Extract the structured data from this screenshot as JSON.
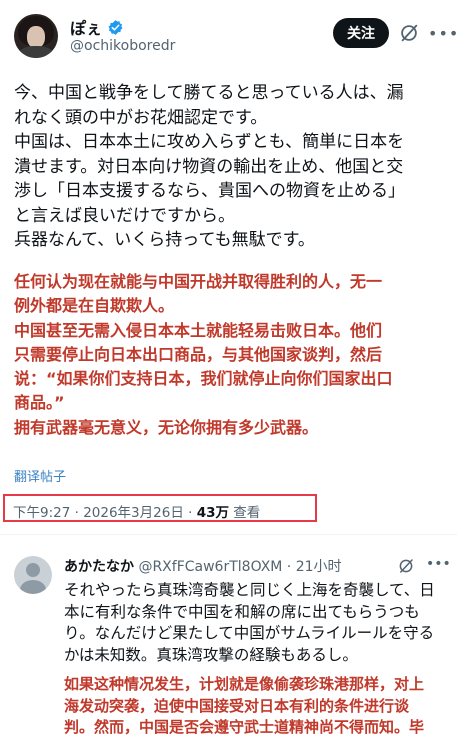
{
  "author": {
    "display_name": "ぽぇ",
    "handle": "@ochikoboredr",
    "avatar": "avatar-icon",
    "verified_icon": "verified-badge-icon"
  },
  "actions": {
    "follow_label": "关注",
    "grok_icon": "grok-slash-icon",
    "more_icon": "more-icon"
  },
  "post": {
    "text": "今、中国と戦争をして勝てると思っている人は、漏\nれなく頭の中がお花畑認定です。\n中国は、日本本土に攻め入らずとも、簡単に日本を\n潰せます。対日本向け物資の輸出を止め、他国と交\n渉し「日本支援するなら、貴国への物資を止める」\nと言えば良いだけですから。\n兵器なんて、いくら持っても無駄です。",
    "translation": "任何认为现在就能与中国开战并取得胜利的人，无一\n例外都是在自欺欺人。\n中国甚至无需入侵日本本土就能轻易击败日本。他们\n只需要停止向日本出口商品，与其他国家谈判，然后\n说：“如果你们支持日本，我们就停止向你们国家出口\n商品。”\n拥有武器毫无意义，无论你拥有多少武器。",
    "translate_link": "翻译帖子",
    "time": "下午9:27 · 2026年3月26日 · ",
    "views_count": "43万",
    "views_label": " 查看"
  },
  "reply": {
    "display_name": "あかたなか",
    "handle": " @RXfFCaw6rTl8OXM · 21小时",
    "text": "それやったら真珠湾奇襲と同じく上海を奇襲して、日\n本に有利な条件で中国を和解の席に出てもらうつも\nり。なんだけど果たして中国がサムライルールを守る\nかは未知数。真珠湾攻撃の経験もあるし。",
    "translation": "如果这种情况发生，计划就是像偷袭珍珠港那样，对上\n海发动突袭，迫使中国接受对日本有利的条件进行谈\n判。然而，中国是否会遵守武士道精神尚不得而知。毕"
  },
  "colors": {
    "accent_red": "#c0392b",
    "highlight_box": "#e8394a",
    "link": "#3b82c4",
    "verified_blue": "#1d9bf0"
  }
}
